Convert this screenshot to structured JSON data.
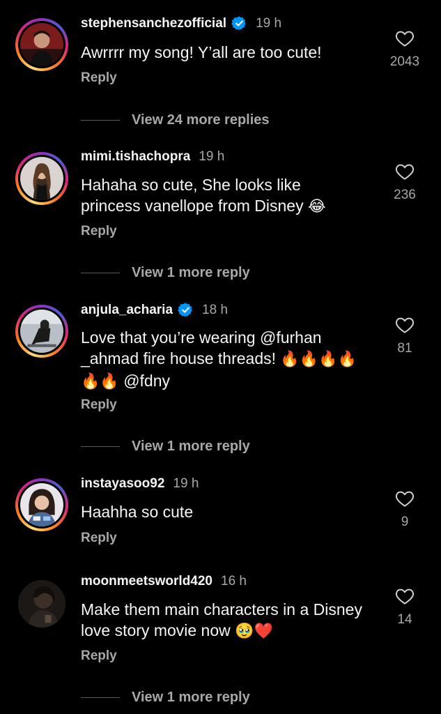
{
  "comments": [
    {
      "username": "stephensanchezofficial",
      "verified": true,
      "time": "19 h",
      "text": "Awrrrr my song! Y’all are too cute!",
      "reply_label": "Reply",
      "likes": "2043",
      "view_more": "View 24 more replies",
      "avatar_ring": true
    },
    {
      "username": "mimi.tishachopra",
      "verified": false,
      "time": "19 h",
      "text_line1": "Hahaha so cute, She looks like",
      "text_line2": "princess vanellope from Disney",
      "emoji": "😂",
      "reply_label": "Reply",
      "likes": "236",
      "view_more": "View 1 more reply",
      "avatar_ring": true
    },
    {
      "username": "anjula_acharia",
      "verified": true,
      "time": "18 h",
      "text_line1": "Love that you’re wearing @furhan",
      "text_line2": "_ahmad fire house threads!",
      "emoji_line2": "🔥🔥🔥🔥",
      "emoji_line3": "🔥🔥",
      "mention_line3": "@fdny",
      "reply_label": "Reply",
      "likes": "81",
      "view_more": "View 1 more reply",
      "avatar_ring": true
    },
    {
      "username": "instayasoo92",
      "verified": false,
      "time": "19 h",
      "text": "Haahha so cute",
      "reply_label": "Reply",
      "likes": "9",
      "avatar_ring": true
    },
    {
      "username": "moonmeetsworld420",
      "verified": false,
      "time": "16 h",
      "text_line1": "Make them main characters in a Disney",
      "text_line2": "love story movie now",
      "emoji": "🥹❤️",
      "reply_label": "Reply",
      "likes": "14",
      "view_more": "View 1 more reply",
      "avatar_ring": false
    }
  ],
  "colors": {
    "background": "#000000",
    "text_primary": "#f5f5f5",
    "text_secondary": "#a8a8a8",
    "verified_blue": "#0095f6"
  }
}
